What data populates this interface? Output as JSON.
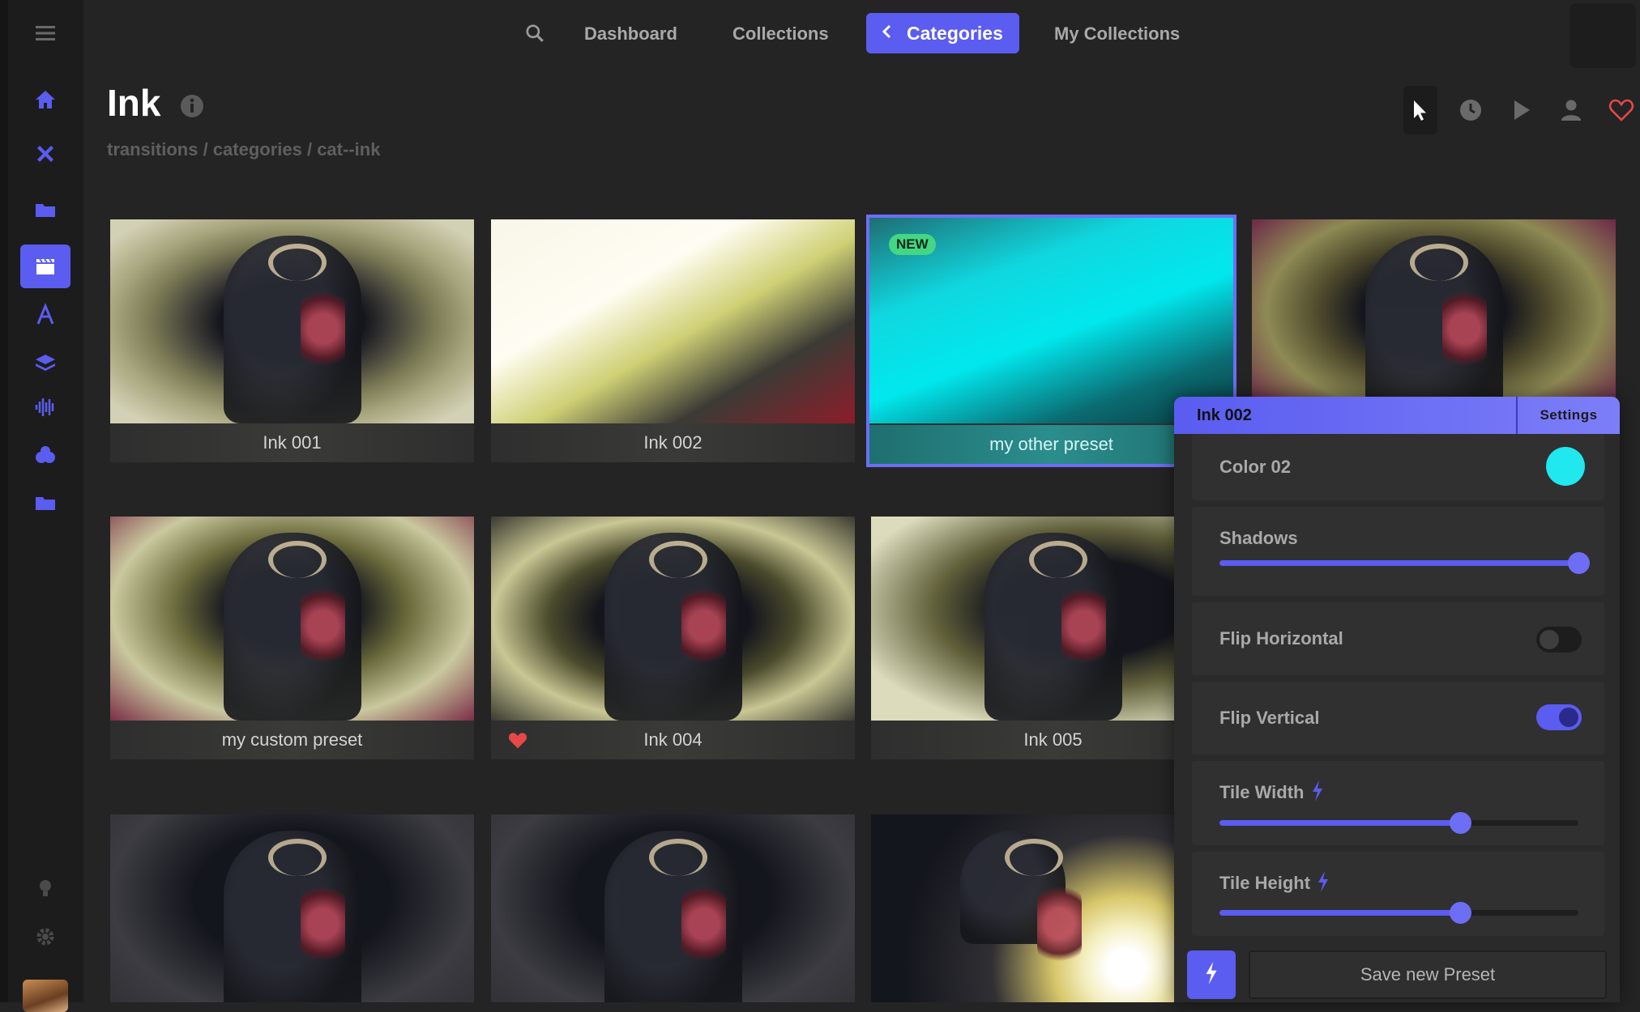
{
  "nav": {
    "links": [
      "Dashboard",
      "Collections",
      "My Collections"
    ],
    "active": "Categories"
  },
  "header": {
    "title": "Ink",
    "breadcrumb": "transitions / categories / cat--ink"
  },
  "cards": [
    {
      "label": "Ink 001"
    },
    {
      "label": "Ink 002"
    },
    {
      "label": "my other preset",
      "badge": "NEW",
      "selected": true
    },
    {
      "label": ""
    },
    {
      "label": "my custom preset"
    },
    {
      "label": "Ink 004",
      "favorite": true
    },
    {
      "label": "Ink 005"
    },
    {
      "label": ""
    },
    {
      "label": ""
    },
    {
      "label": ""
    }
  ],
  "panel": {
    "title": "Ink 002",
    "tab": "Settings",
    "color": {
      "label": "Color 02",
      "value": "#21e7ee"
    },
    "shadows": {
      "label": "Shadows",
      "value": 1.0
    },
    "flip_h": {
      "label": "Flip Horizontal",
      "on": false
    },
    "flip_v": {
      "label": "Flip Vertical",
      "on": true
    },
    "tile_w": {
      "label": "Tile Width",
      "value": 0.67
    },
    "tile_h": {
      "label": "Tile Height",
      "value": 0.67
    },
    "save_label": "Save new Preset"
  },
  "colors": {
    "accent": "#5b5cf0",
    "new_badge": "#44d685",
    "heart": "#e64848"
  },
  "sidebar_icons": [
    "home-icon",
    "tools-icon",
    "folder-icon",
    "clapperboard-icon",
    "text-icon",
    "layers-icon",
    "waveform-icon",
    "blob-icon",
    "folder-icon",
    "lightbulb-icon",
    "gear-icon"
  ],
  "toolbar_icons": [
    "cursor-icon",
    "clock-icon",
    "play-icon",
    "user-icon",
    "heart-icon"
  ]
}
